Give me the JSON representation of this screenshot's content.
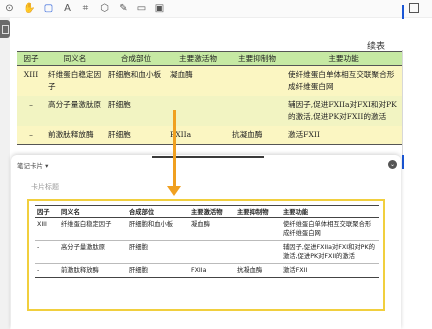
{
  "toolbar": {
    "icons": [
      "zoom-fit-icon",
      "hand-icon",
      "select-box-icon",
      "text-icon",
      "crop-icon",
      "lasso-icon",
      "pen-icon",
      "note-icon",
      "image-icon",
      "window-icon"
    ]
  },
  "document": {
    "continued_label": "续表",
    "headers": [
      "因子",
      "同义名",
      "合成部位",
      "主要激活物",
      "主要抑制物",
      "主要功能"
    ],
    "rows": [
      [
        "XIII",
        "纤维蛋白稳定因子",
        "肝细胞和血小板",
        "凝血酶",
        "",
        "使纤维蛋白单体相互交联聚合形成纤维蛋白网"
      ],
      [
        "–",
        "高分子量激肽原",
        "肝细胞",
        "",
        "",
        "辅因子,促进FXIIa对FXI和对PK的激活,促进PK对FXII的激活"
      ],
      [
        "–",
        "前激肽释放酶",
        "肝细胞",
        "FXIIa",
        "抗凝血酶",
        "激活FXII"
      ]
    ]
  },
  "card": {
    "header": "笔记卡片 ▾",
    "placeholder_title": "卡片标题",
    "headers": [
      "因子",
      "同义名",
      "合成部位",
      "主要激活物",
      "主要抑制物",
      "主要功能"
    ],
    "rows": [
      [
        "XIII",
        "纤维蛋白稳定因子",
        "肝细胞和血小板",
        "凝血酶",
        "",
        "使纤维蛋白单体相互交联聚合形成纤维蛋白网"
      ],
      [
        "-",
        "高分子量激肽原",
        "肝细胞",
        "",
        "",
        "辅因子,促进FXIIa对FXI和对PK的激活,促进PK对FXII的激活"
      ],
      [
        "-",
        "前激肽释放酶",
        "肝细胞",
        "FXIIa",
        "抗凝血酶",
        "激活FXII"
      ]
    ]
  },
  "colors": {
    "header_green": "#c6e9a3",
    "row_yellow": "#fbf6c2",
    "arrow_orange": "#f0a020",
    "card_border": "#f1cf3e",
    "accent_blue": "#1a56d6"
  }
}
